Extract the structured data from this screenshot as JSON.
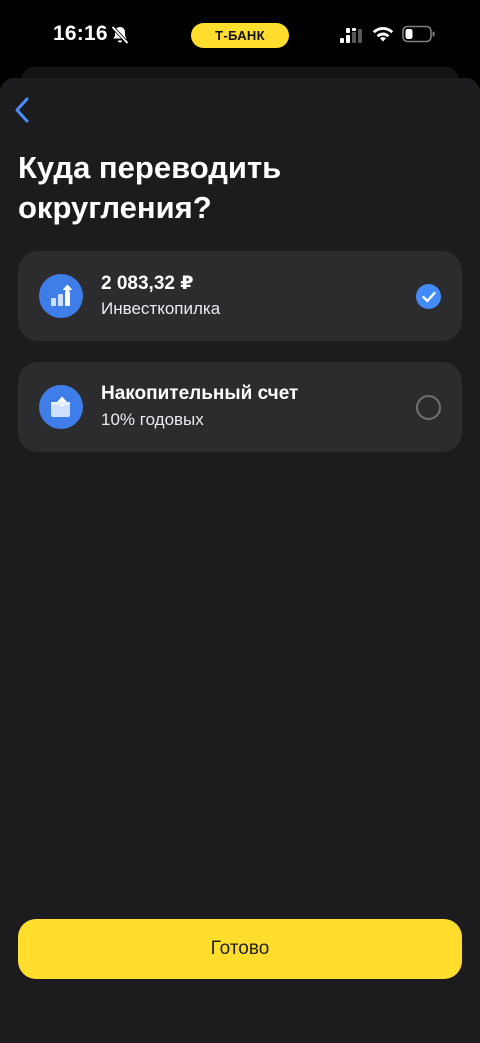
{
  "status_bar": {
    "time": "16:16",
    "bank_label": "Т-БАНК"
  },
  "header": {
    "title": "Куда переводить округления?"
  },
  "options": [
    {
      "title": "2 083,32 ₽",
      "subtitle": "Инвесткопилка",
      "icon": "invest-chart-icon",
      "selected": true
    },
    {
      "title": "Накопительный счет",
      "subtitle": "10% годовых",
      "icon": "savings-wallet-icon",
      "selected": false
    }
  ],
  "footer": {
    "done_label": "Готово"
  },
  "colors": {
    "accent_yellow": "#ffdd2d",
    "accent_blue": "#428bf9",
    "icon_blue": "#3f7de8",
    "card_bg": "#2c2c2e",
    "sheet_bg": "#1c1c1e"
  }
}
